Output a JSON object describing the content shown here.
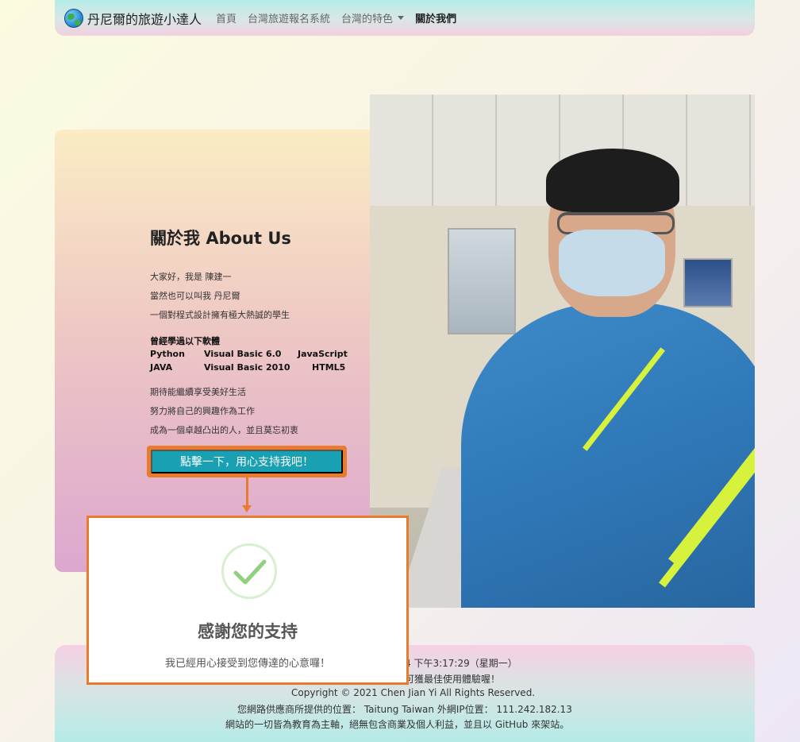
{
  "navbar": {
    "brand": "丹尼爾的旅遊小達人",
    "items": [
      "首頁",
      "台灣旅遊報名系統",
      "台灣的特色",
      "關於我們"
    ]
  },
  "about": {
    "title_cn": "關於我",
    "title_en": "About Us",
    "intro": [
      "大家好，我是 陳建一",
      "當然也可以叫我 丹尼爾",
      "一個對程式設計擁有極大熱誠的學生"
    ],
    "skills_heading": "曾經學過以下軟體",
    "skills": [
      [
        "Python",
        "Visual Basic 6.0",
        "JavaScript"
      ],
      [
        "JAVA",
        "Visual Basic 2010",
        "HTML5"
      ]
    ],
    "outro": [
      "期待能繼續享受美好生活",
      "努力將自己的興趣作為工作",
      "成為一個卓越凸出的人，並且莫忘初衷"
    ],
    "button": "點擊一下，用心支持我吧！"
  },
  "popup": {
    "title": "感謝您的支持",
    "text": "我已經用心接受到您傳達的心意囉！"
  },
  "footer": {
    "line1": "4 下午3:17:29（星期一）",
    "line2": "可獲最佳使用體驗喔！",
    "line3": "Copyright © 2021 Chen Jian Yi All Rights Reserved.",
    "line4": "您網路供應商所提供的位置： Taitung Taiwan   外網IP位置： 111.242.182.13",
    "line5": "網站的一切皆為教育為主軸，絕無包含商業及個人利益，並且以 GitHub 來架站。"
  }
}
